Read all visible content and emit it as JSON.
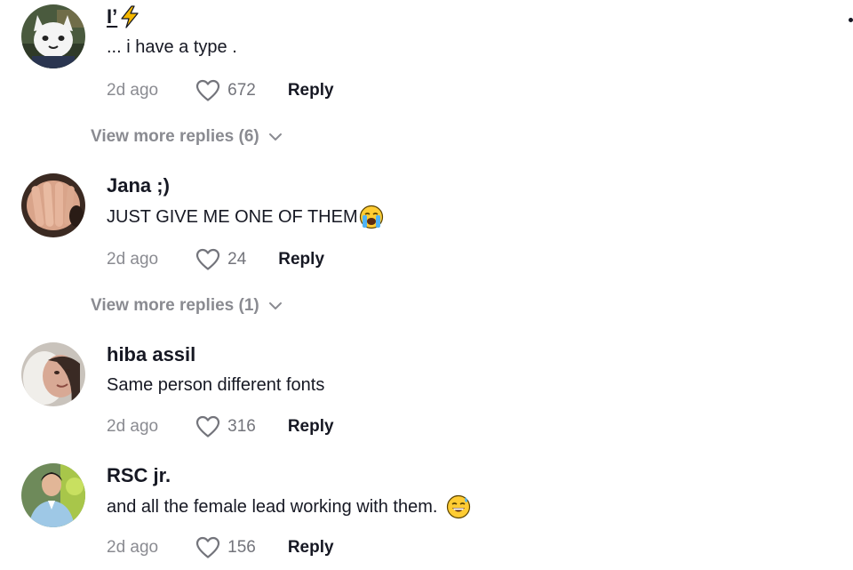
{
  "comments": [
    {
      "username": "I’",
      "text": "... i have a type .",
      "date": "2d ago",
      "likes": "672",
      "reply_label": "Reply",
      "avatar_icon": "white-cat-cartoon-avatar"
    },
    {
      "username": "Jana ;)",
      "text": "JUST GIVE ME ONE OF THEM",
      "date": "2d ago",
      "likes": "24",
      "reply_label": "Reply",
      "avatar_icon": "hand-photo-avatar"
    },
    {
      "username": "hiba assil",
      "text": "Same person different fonts",
      "date": "2d ago",
      "likes": "316",
      "reply_label": "Reply",
      "avatar_icon": "face-photo-avatar"
    },
    {
      "username": "RSC jr.",
      "text": "and all the female lead working with them.",
      "date": "2d ago",
      "likes": "156",
      "reply_label": "Reply",
      "avatar_icon": "man-outdoor-photo-avatar"
    }
  ],
  "view_more": [
    {
      "label": "View more replies (6)"
    },
    {
      "label": "View more replies (1)"
    }
  ],
  "icons": {
    "like": "heart-outline-icon",
    "expand": "chevron-down-icon",
    "bolt": "lightning-bolt-emoji",
    "crying": "loudly-crying-face-emoji",
    "sweat": "grinning-face-with-sweat-emoji"
  },
  "colors": {
    "text": "#161823",
    "muted": "#8a8b91",
    "bolt": "#f5b800"
  }
}
